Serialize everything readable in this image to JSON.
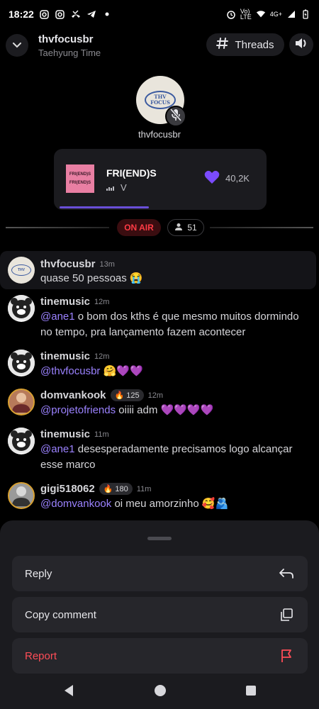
{
  "status_bar": {
    "time": "18:22",
    "icons_left": [
      "instagram-icon",
      "instagram-icon",
      "missed-call-icon",
      "telegram-icon",
      "dot-icon"
    ],
    "network_label_1": "Vo)",
    "network_label_2": "LTE",
    "signal_label": "4G+"
  },
  "header": {
    "title": "thvfocusbr",
    "subtitle": "Taehyung Time",
    "threads_label": "Threads"
  },
  "host": {
    "name": "thvfocusbr",
    "logo_line1": "THV",
    "logo_line2": "FOCUS",
    "muted": true
  },
  "music": {
    "song": "FRI(END)S",
    "artist": "V",
    "likes": "40,2K",
    "album_text_1": "FRI(END)S",
    "album_text_2": "FRI(END)S",
    "progress": 0.42
  },
  "live": {
    "status": "ON AIR",
    "listeners": "51"
  },
  "comments": [
    {
      "user": "thvfocusbr",
      "time": "13m",
      "badge": "",
      "mention": "",
      "text": "quase 50 pessoas 😭",
      "avatar": "thv-logo"
    },
    {
      "user": "tinemusic",
      "time": "12m",
      "badge": "",
      "mention": "@ane1",
      "text": " o bom dos kths é que mesmo muitos dormindo no tempo, pra lançamento fazem acontecer",
      "avatar": "bear"
    },
    {
      "user": "tinemusic",
      "time": "12m",
      "badge": "",
      "mention": "@thvfocusbr",
      "text": " 🤗💜💜",
      "avatar": "bear"
    },
    {
      "user": "domvankook",
      "time": "12m",
      "badge": "125",
      "mention": "@projetofriends",
      "text": " oiiii adm 💜💜💜💜",
      "avatar": "person"
    },
    {
      "user": "tinemusic",
      "time": "11m",
      "badge": "",
      "mention": "@ane1",
      "text": " desesperadamente precisamos logo alcançar esse marco",
      "avatar": "bear"
    },
    {
      "user": "gigi518062",
      "time": "11m",
      "badge": "180",
      "mention": "@domvankook",
      "text": " oi meu amorzinho 🥰🫂",
      "avatar": "person2"
    }
  ],
  "sheet": {
    "reply": "Reply",
    "copy": "Copy comment",
    "report": "Report"
  },
  "colors": {
    "accent": "#9b82ff",
    "danger": "#ff4d57",
    "sheet_bg": "#1b1b1f"
  }
}
